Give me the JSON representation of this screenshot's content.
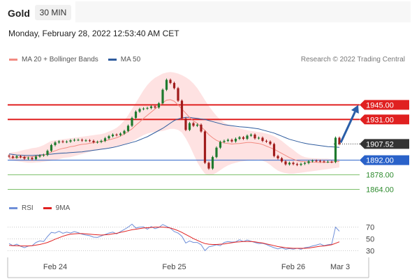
{
  "header": {
    "symbol": "Gold",
    "timeframe": "30 MIN",
    "datetime": "Monday, February 28, 2022 12:53:40 AM CET",
    "copyright": "Research © 2022 Trading Central"
  },
  "legend": {
    "ma20_label": "MA 20 + Bollinger Bands",
    "ma50_label": "MA 50",
    "rsi_label": "RSI",
    "ma9_label": "9MA"
  },
  "colors": {
    "ma20": "#f28b82",
    "ma50": "#2f5c9e",
    "band": "#fdd5d5",
    "resistance": "#e02020",
    "pivot": "#2a62c9",
    "support": "#7bbf6a",
    "current": "#333333",
    "rsi": "#6f8fd8",
    "rsi_ma": "#e02020",
    "candle_up": "#1e7a2e",
    "candle_down": "#a01c1c",
    "arrow": "#2a5ea8"
  },
  "chart_data": [
    {
      "type": "line",
      "name": "price",
      "x_labels": [
        "Feb 24",
        "Feb 25",
        "Feb 26",
        "Mar 3"
      ],
      "ylim": [
        1855,
        1980
      ],
      "candles": [
        1895.5,
        1894.5,
        1895.8,
        1895.0,
        1893.5,
        1894.2,
        1893.0,
        1895.5,
        1896.5,
        1897.0,
        1901.0,
        1906.5,
        1909.0,
        1910.0,
        1909.5,
        1909.8,
        1911.0,
        1911.5,
        1911.5,
        1910.8,
        1911.0,
        1910.5,
        1909.2,
        1909.5,
        1910.5,
        1913.0,
        1915.0,
        1916.5,
        1916.0,
        1917.5,
        1920.0,
        1925.0,
        1932.5,
        1938.5,
        1941.0,
        1941.5,
        1942.0,
        1943.5,
        1942.5,
        1946.5,
        1959.5,
        1969.0,
        1966.0,
        1961.0,
        1949.0,
        1932.0,
        1921.0,
        1927.5,
        1925.0,
        1926.0,
        1919.5,
        1889.5,
        1884.0,
        1895.0,
        1904.0,
        1909.5,
        1910.5,
        1911.5,
        1910.0,
        1912.5,
        1914.0,
        1912.5,
        1915.5,
        1916.5,
        1913.0,
        1913.5,
        1910.5,
        1909.8,
        1907.5,
        1896.0,
        1893.8,
        1890.8,
        1888.0,
        1889.5,
        1888.3,
        1887.5,
        1888.5,
        1889.3,
        1891.0,
        1891.5,
        1891.3,
        1890.8,
        1890.5,
        1890.5,
        1890.3,
        1913.5,
        1907.52
      ],
      "ma20": [
        1894.0,
        1894.2,
        1894.5,
        1894.8,
        1895.0,
        1895.2,
        1895.3,
        1895.8,
        1896.3,
        1897.0,
        1898.2,
        1899.7,
        1901.0,
        1902.3,
        1903.3,
        1904.0,
        1905.0,
        1905.5,
        1906.5,
        1907.2,
        1907.5,
        1908.2,
        1908.8,
        1909.5,
        1910.0,
        1910.5,
        1911.5,
        1912.5,
        1913.5,
        1915.0,
        1917.0,
        1919.5,
        1922.0,
        1925.5,
        1928.5,
        1932.0,
        1935.0,
        1938.0,
        1941.0,
        1944.0,
        1947.0,
        1949.5,
        1950.0,
        1948.5,
        1945.0,
        1941.0,
        1937.0,
        1933.0,
        1929.5,
        1927.5,
        1924.0,
        1920.5,
        1916.5,
        1913.5,
        1911.0,
        1909.5,
        1908.5,
        1908.0,
        1907.5,
        1907.8,
        1908.0,
        1908.5,
        1909.0,
        1909.0,
        1908.5,
        1908.0,
        1907.0,
        1905.5,
        1904.0,
        1902.5,
        1900.5,
        1898.5,
        1896.5,
        1894.5,
        1893.0,
        1891.5,
        1890.8,
        1890.5,
        1890.3,
        1890.0,
        1890.0,
        1889.8,
        1890.0,
        1890.0,
        1890.3,
        1890.5,
        1890.8
      ],
      "bb_upper": [
        1899.0,
        1899.5,
        1900.0,
        1901.0,
        1902.0,
        1902.5,
        1903.5,
        1904.0,
        1905.0,
        1906.5,
        1908.5,
        1910.5,
        1911.0,
        1911.5,
        1912.0,
        1912.5,
        1913.0,
        1913.5,
        1914.0,
        1914.5,
        1915.0,
        1915.5,
        1916.0,
        1916.5,
        1917.0,
        1918.0,
        1919.5,
        1921.0,
        1923.0,
        1926.0,
        1930.0,
        1935.0,
        1941.0,
        1947.0,
        1953.0,
        1959.0,
        1964.0,
        1968.0,
        1971.0,
        1973.0,
        1975.0,
        1976.0,
        1976.5,
        1976.0,
        1975.0,
        1973.5,
        1971.5,
        1969.0,
        1965.5,
        1961.0,
        1955.5,
        1949.5,
        1944.0,
        1939.0,
        1934.5,
        1931.0,
        1928.0,
        1926.0,
        1924.5,
        1923.5,
        1922.5,
        1921.5,
        1920.8,
        1920.0,
        1919.5,
        1919.0,
        1918.5,
        1917.5,
        1916.5,
        1915.0,
        1913.0,
        1910.5,
        1907.5,
        1904.5,
        1902.0,
        1899.0,
        1896.5,
        1895.0,
        1894.3,
        1894.0,
        1893.8,
        1893.5,
        1893.5,
        1893.5,
        1893.0,
        1893.0,
        1893.0
      ],
      "bb_lower": [
        1892.0,
        1891.5,
        1891.0,
        1890.5,
        1890.0,
        1889.5,
        1889.5,
        1889.8,
        1890.0,
        1890.5,
        1891.0,
        1891.5,
        1892.0,
        1893.0,
        1894.0,
        1894.5,
        1895.0,
        1896.0,
        1897.0,
        1898.0,
        1899.0,
        1900.0,
        1901.0,
        1901.5,
        1902.0,
        1903.0,
        1903.5,
        1904.5,
        1905.0,
        1906.0,
        1907.0,
        1908.5,
        1910.0,
        1912.0,
        1914.0,
        1916.0,
        1917.5,
        1918.5,
        1919.0,
        1919.5,
        1920.0,
        1921.0,
        1922.0,
        1922.0,
        1921.0,
        1918.5,
        1913.0,
        1906.0,
        1898.0,
        1890.0,
        1884.0,
        1879.0,
        1877.5,
        1878.0,
        1880.0,
        1882.5,
        1885.0,
        1887.0,
        1888.5,
        1889.5,
        1890.5,
        1891.0,
        1891.5,
        1892.0,
        1892.3,
        1892.5,
        1891.5,
        1890.0,
        1887.5,
        1884.5,
        1882.0,
        1880.5,
        1879.5,
        1879.0,
        1879.0,
        1879.5,
        1880.0,
        1880.5,
        1881.0,
        1881.5,
        1882.0,
        1882.5,
        1883.0,
        1883.5,
        1884.0,
        1884.5,
        1885.0
      ],
      "ma50": [
        1898.0,
        1897.5,
        1897.0,
        1896.8,
        1896.5,
        1896.5,
        1896.5,
        1896.8,
        1897.0,
        1897.3,
        1897.5,
        1897.8,
        1898.2,
        1898.5,
        1898.8,
        1899.0,
        1899.3,
        1899.5,
        1899.8,
        1900.0,
        1900.5,
        1901.0,
        1901.5,
        1902.0,
        1902.5,
        1903.0,
        1903.5,
        1904.2,
        1905.0,
        1906.0,
        1907.0,
        1908.0,
        1909.0,
        1910.0,
        1911.5,
        1913.0,
        1914.5,
        1916.5,
        1918.5,
        1920.5,
        1922.5,
        1925.0,
        1927.5,
        1930.0,
        1931.5,
        1932.5,
        1933.0,
        1933.0,
        1932.5,
        1932.0,
        1931.5,
        1931.0,
        1930.0,
        1929.0,
        1928.0,
        1927.0,
        1926.0,
        1925.5,
        1925.0,
        1924.5,
        1924.0,
        1923.8,
        1923.5,
        1923.0,
        1922.5,
        1922.0,
        1921.0,
        1920.0,
        1919.0,
        1918.0,
        1916.5,
        1915.0,
        1913.5,
        1912.0,
        1911.0,
        1910.0,
        1909.0,
        1908.2,
        1907.5,
        1907.0,
        1906.5,
        1906.0,
        1905.5,
        1905.0,
        1904.8,
        1904.5,
        1904.3
      ],
      "levels": [
        {
          "label": "1945.00",
          "value": 1945.0,
          "kind": "resistance"
        },
        {
          "label": "1931.00",
          "value": 1931.0,
          "kind": "resistance"
        },
        {
          "label": "1907.52",
          "value": 1907.52,
          "kind": "current"
        },
        {
          "label": "1892.00",
          "value": 1892.0,
          "kind": "pivot"
        },
        {
          "label": "1878.00",
          "value": 1878.0,
          "kind": "support"
        },
        {
          "label": "1864.00",
          "value": 1864.0,
          "kind": "support"
        }
      ],
      "projection": {
        "from": 1907.52,
        "to": 1945.0
      }
    },
    {
      "type": "line",
      "name": "RSI",
      "ylim": [
        15,
        85
      ],
      "yticks": [
        "70",
        "50",
        "30"
      ],
      "ytick_values": [
        70,
        50,
        30
      ],
      "rsi": [
        42.0,
        38.5,
        41.0,
        37.5,
        35.0,
        37.8,
        38.5,
        44.0,
        46.5,
        45.5,
        54.0,
        61.0,
        60.0,
        63.0,
        59.5,
        61.5,
        60.0,
        62.5,
        60.5,
        58.0,
        56.5,
        55.5,
        53.0,
        52.5,
        55.0,
        57.5,
        60.0,
        61.5,
        58.5,
        62.5,
        66.0,
        70.0,
        75.0,
        68.5,
        70.0,
        70.5,
        66.5,
        71.0,
        67.5,
        69.5,
        74.5,
        71.5,
        68.0,
        62.5,
        60.0,
        54.5,
        43.0,
        46.5,
        44.0,
        44.0,
        40.0,
        30.0,
        36.5,
        38.0,
        40.0,
        38.5,
        44.0,
        45.5,
        44.5,
        45.0,
        48.5,
        45.5,
        48.0,
        46.0,
        44.0,
        42.0,
        42.5,
        40.5,
        37.5,
        35.0,
        33.0,
        35.0,
        32.5,
        33.5,
        32.5,
        34.0,
        32.5,
        35.0,
        36.0,
        38.0,
        39.5,
        41.5,
        38.5,
        40.0,
        41.0,
        70.0,
        63.0
      ],
      "rsi_ma9": [
        39.0,
        38.5,
        38.5,
        38.0,
        38.0,
        38.0,
        38.5,
        39.5,
        40.5,
        42.0,
        44.0,
        46.5,
        49.5,
        52.0,
        54.5,
        56.5,
        58.0,
        58.5,
        59.0,
        59.0,
        58.5,
        58.0,
        57.5,
        57.0,
        56.5,
        57.0,
        57.5,
        58.5,
        59.5,
        61.0,
        62.5,
        64.0,
        65.5,
        66.5,
        67.5,
        68.5,
        69.0,
        69.5,
        70.0,
        70.0,
        70.0,
        69.5,
        68.5,
        66.5,
        64.0,
        61.0,
        57.5,
        54.0,
        50.5,
        47.5,
        44.5,
        42.0,
        41.0,
        40.5,
        40.5,
        41.0,
        41.5,
        42.5,
        43.5,
        44.5,
        45.0,
        45.5,
        45.5,
        45.5,
        45.0,
        44.0,
        43.0,
        41.5,
        40.0,
        38.5,
        37.0,
        36.0,
        35.0,
        34.5,
        34.0,
        34.0,
        34.0,
        34.0,
        34.5,
        35.5,
        36.5,
        37.5,
        38.0,
        39.0,
        40.0,
        42.5,
        45.0
      ]
    }
  ]
}
